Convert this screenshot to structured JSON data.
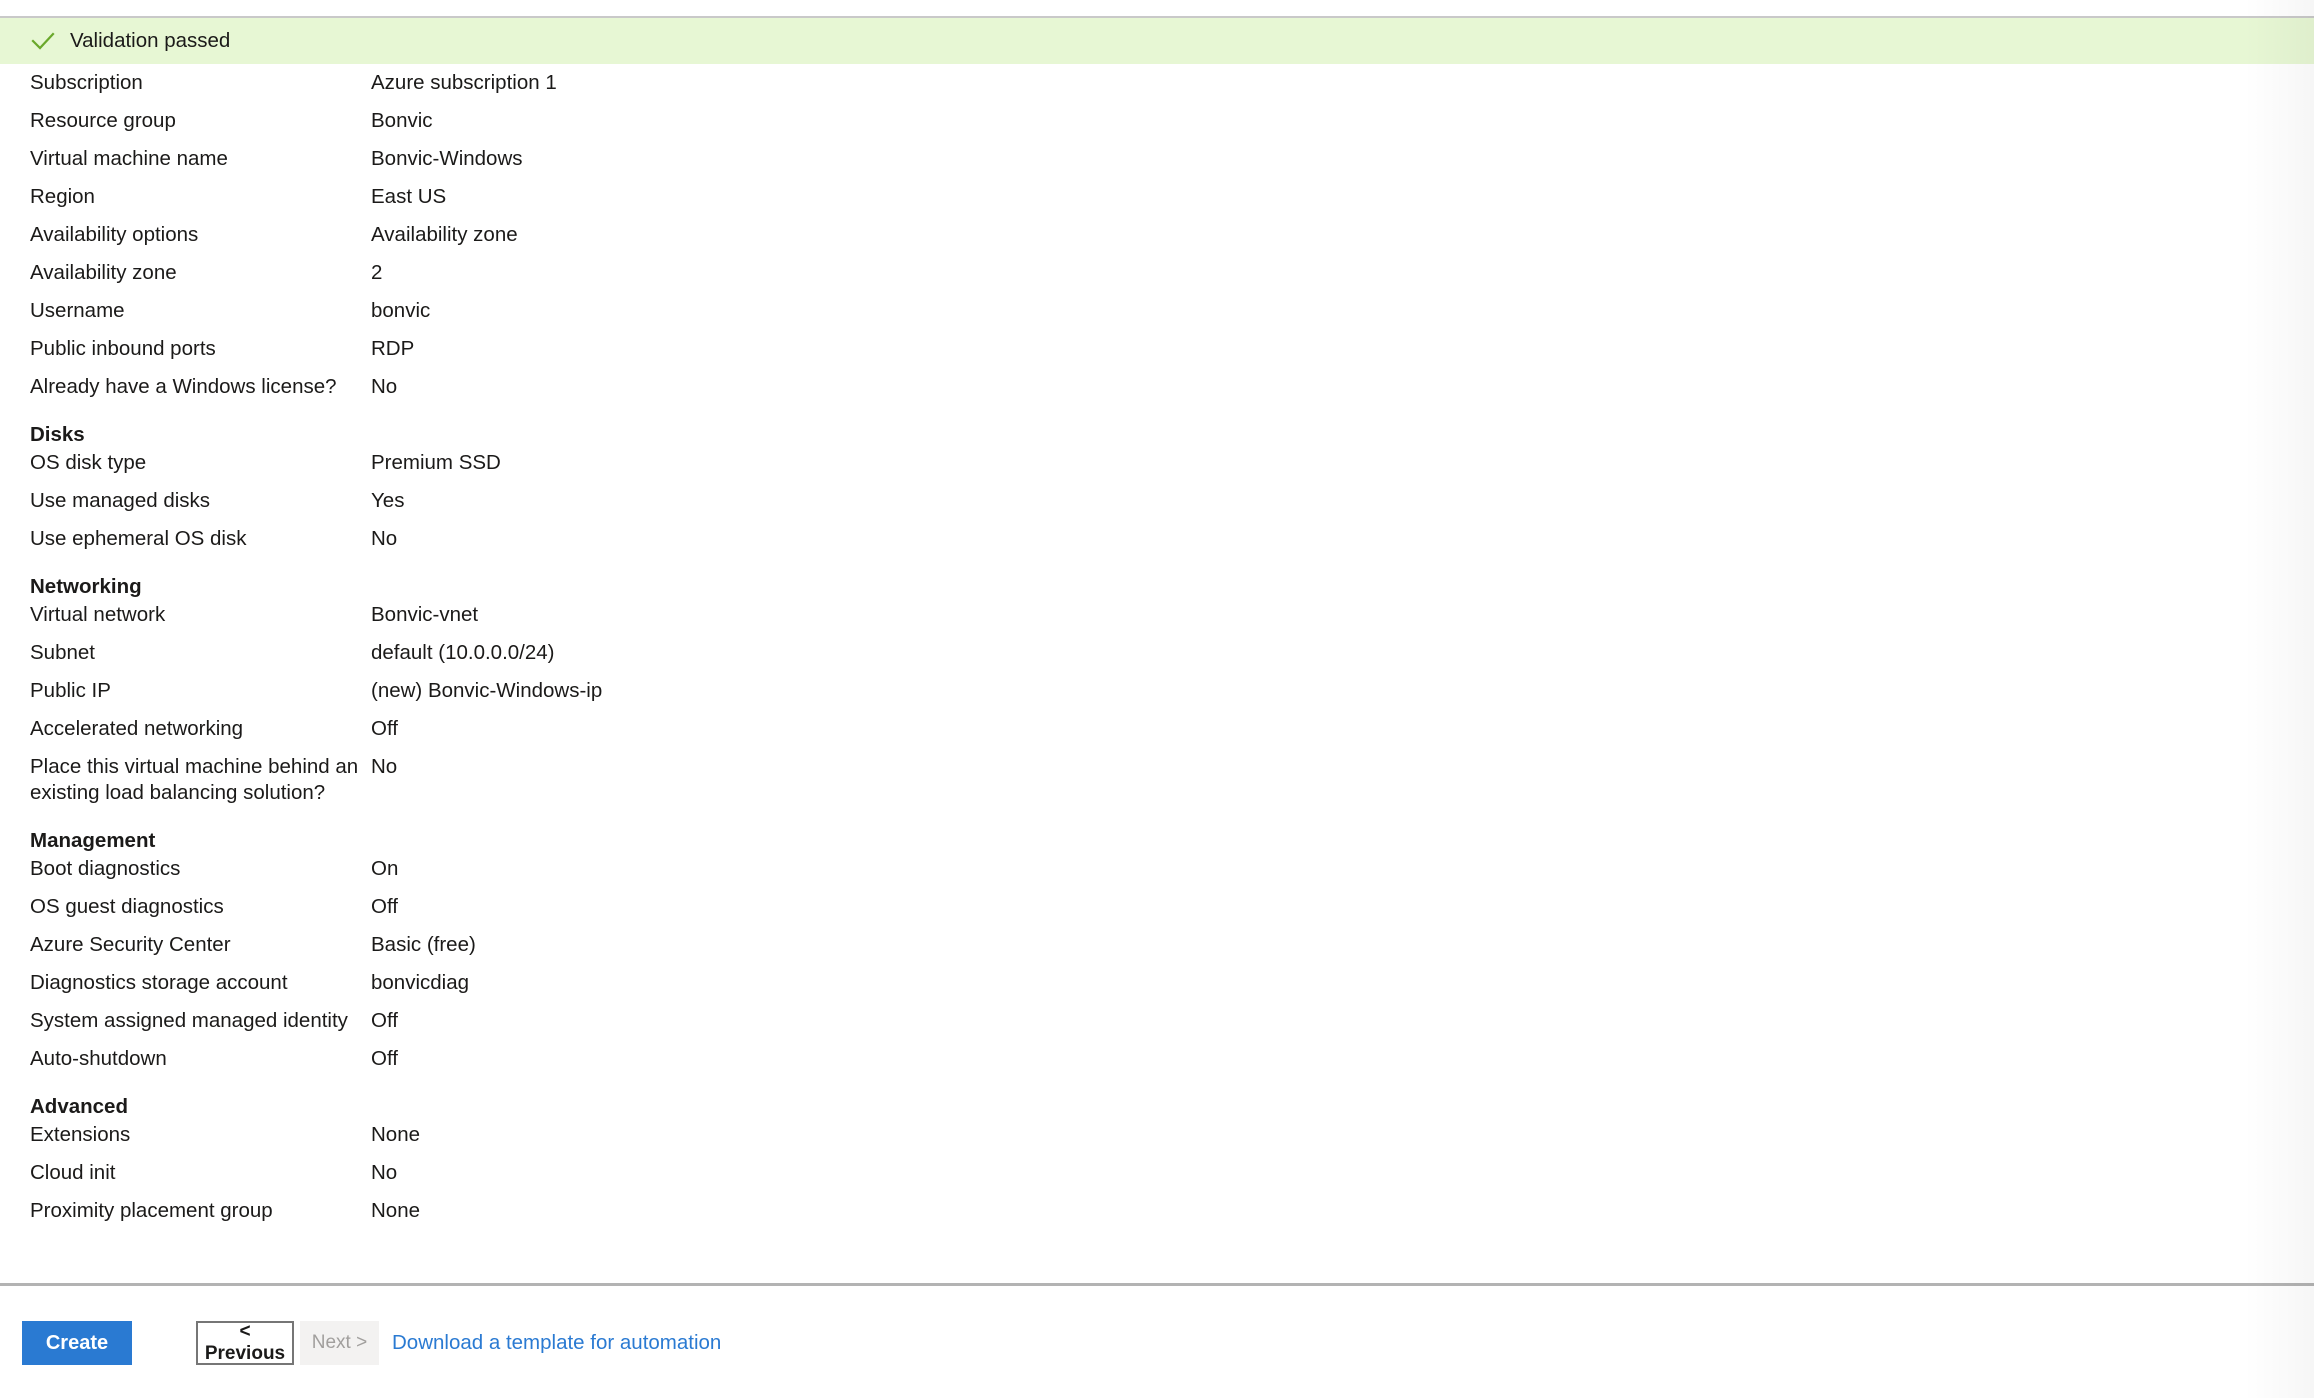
{
  "banner": {
    "icon": "check-icon",
    "text": "Validation passed",
    "background_color": "#e7f7d4",
    "icon_color": "#6aa82b"
  },
  "summary": {
    "basics": [
      {
        "label": "Subscription",
        "value": "Azure subscription 1"
      },
      {
        "label": "Resource group",
        "value": "Bonvic"
      },
      {
        "label": "Virtual machine name",
        "value": "Bonvic-Windows"
      },
      {
        "label": "Region",
        "value": "East US"
      },
      {
        "label": "Availability options",
        "value": "Availability zone"
      },
      {
        "label": "Availability zone",
        "value": "2"
      },
      {
        "label": "Username",
        "value": "bonvic"
      },
      {
        "label": "Public inbound ports",
        "value": "RDP"
      },
      {
        "label": "Already have a Windows license?",
        "value": "No"
      }
    ],
    "sections": [
      {
        "header": "Disks",
        "rows": [
          {
            "label": "OS disk type",
            "value": "Premium SSD"
          },
          {
            "label": "Use managed disks",
            "value": "Yes"
          },
          {
            "label": "Use ephemeral OS disk",
            "value": "No"
          }
        ]
      },
      {
        "header": "Networking",
        "rows": [
          {
            "label": "Virtual network",
            "value": "Bonvic-vnet"
          },
          {
            "label": "Subnet",
            "value": "default (10.0.0.0/24)"
          },
          {
            "label": "Public IP",
            "value": "(new) Bonvic-Windows-ip"
          },
          {
            "label": "Accelerated networking",
            "value": "Off"
          },
          {
            "label": "Place this virtual machine behind an existing load balancing solution?",
            "value": "No",
            "two_line": true
          }
        ]
      },
      {
        "header": "Management",
        "rows": [
          {
            "label": "Boot diagnostics",
            "value": "On"
          },
          {
            "label": "OS guest diagnostics",
            "value": "Off"
          },
          {
            "label": "Azure Security Center",
            "value": "Basic (free)"
          },
          {
            "label": "Diagnostics storage account",
            "value": "bonvicdiag"
          },
          {
            "label": "System assigned managed identity",
            "value": "Off"
          },
          {
            "label": "Auto-shutdown",
            "value": "Off"
          }
        ]
      },
      {
        "header": "Advanced",
        "rows": [
          {
            "label": "Extensions",
            "value": "None"
          },
          {
            "label": "Cloud init",
            "value": "No"
          },
          {
            "label": "Proximity placement group",
            "value": "None"
          }
        ]
      }
    ]
  },
  "footer": {
    "create_label": "Create",
    "previous_label": "< Previous",
    "next_label": "Next >",
    "next_disabled": true,
    "template_link_label": "Download a template for automation",
    "primary_color": "#2a7ad2",
    "link_color": "#2a7ad2"
  }
}
